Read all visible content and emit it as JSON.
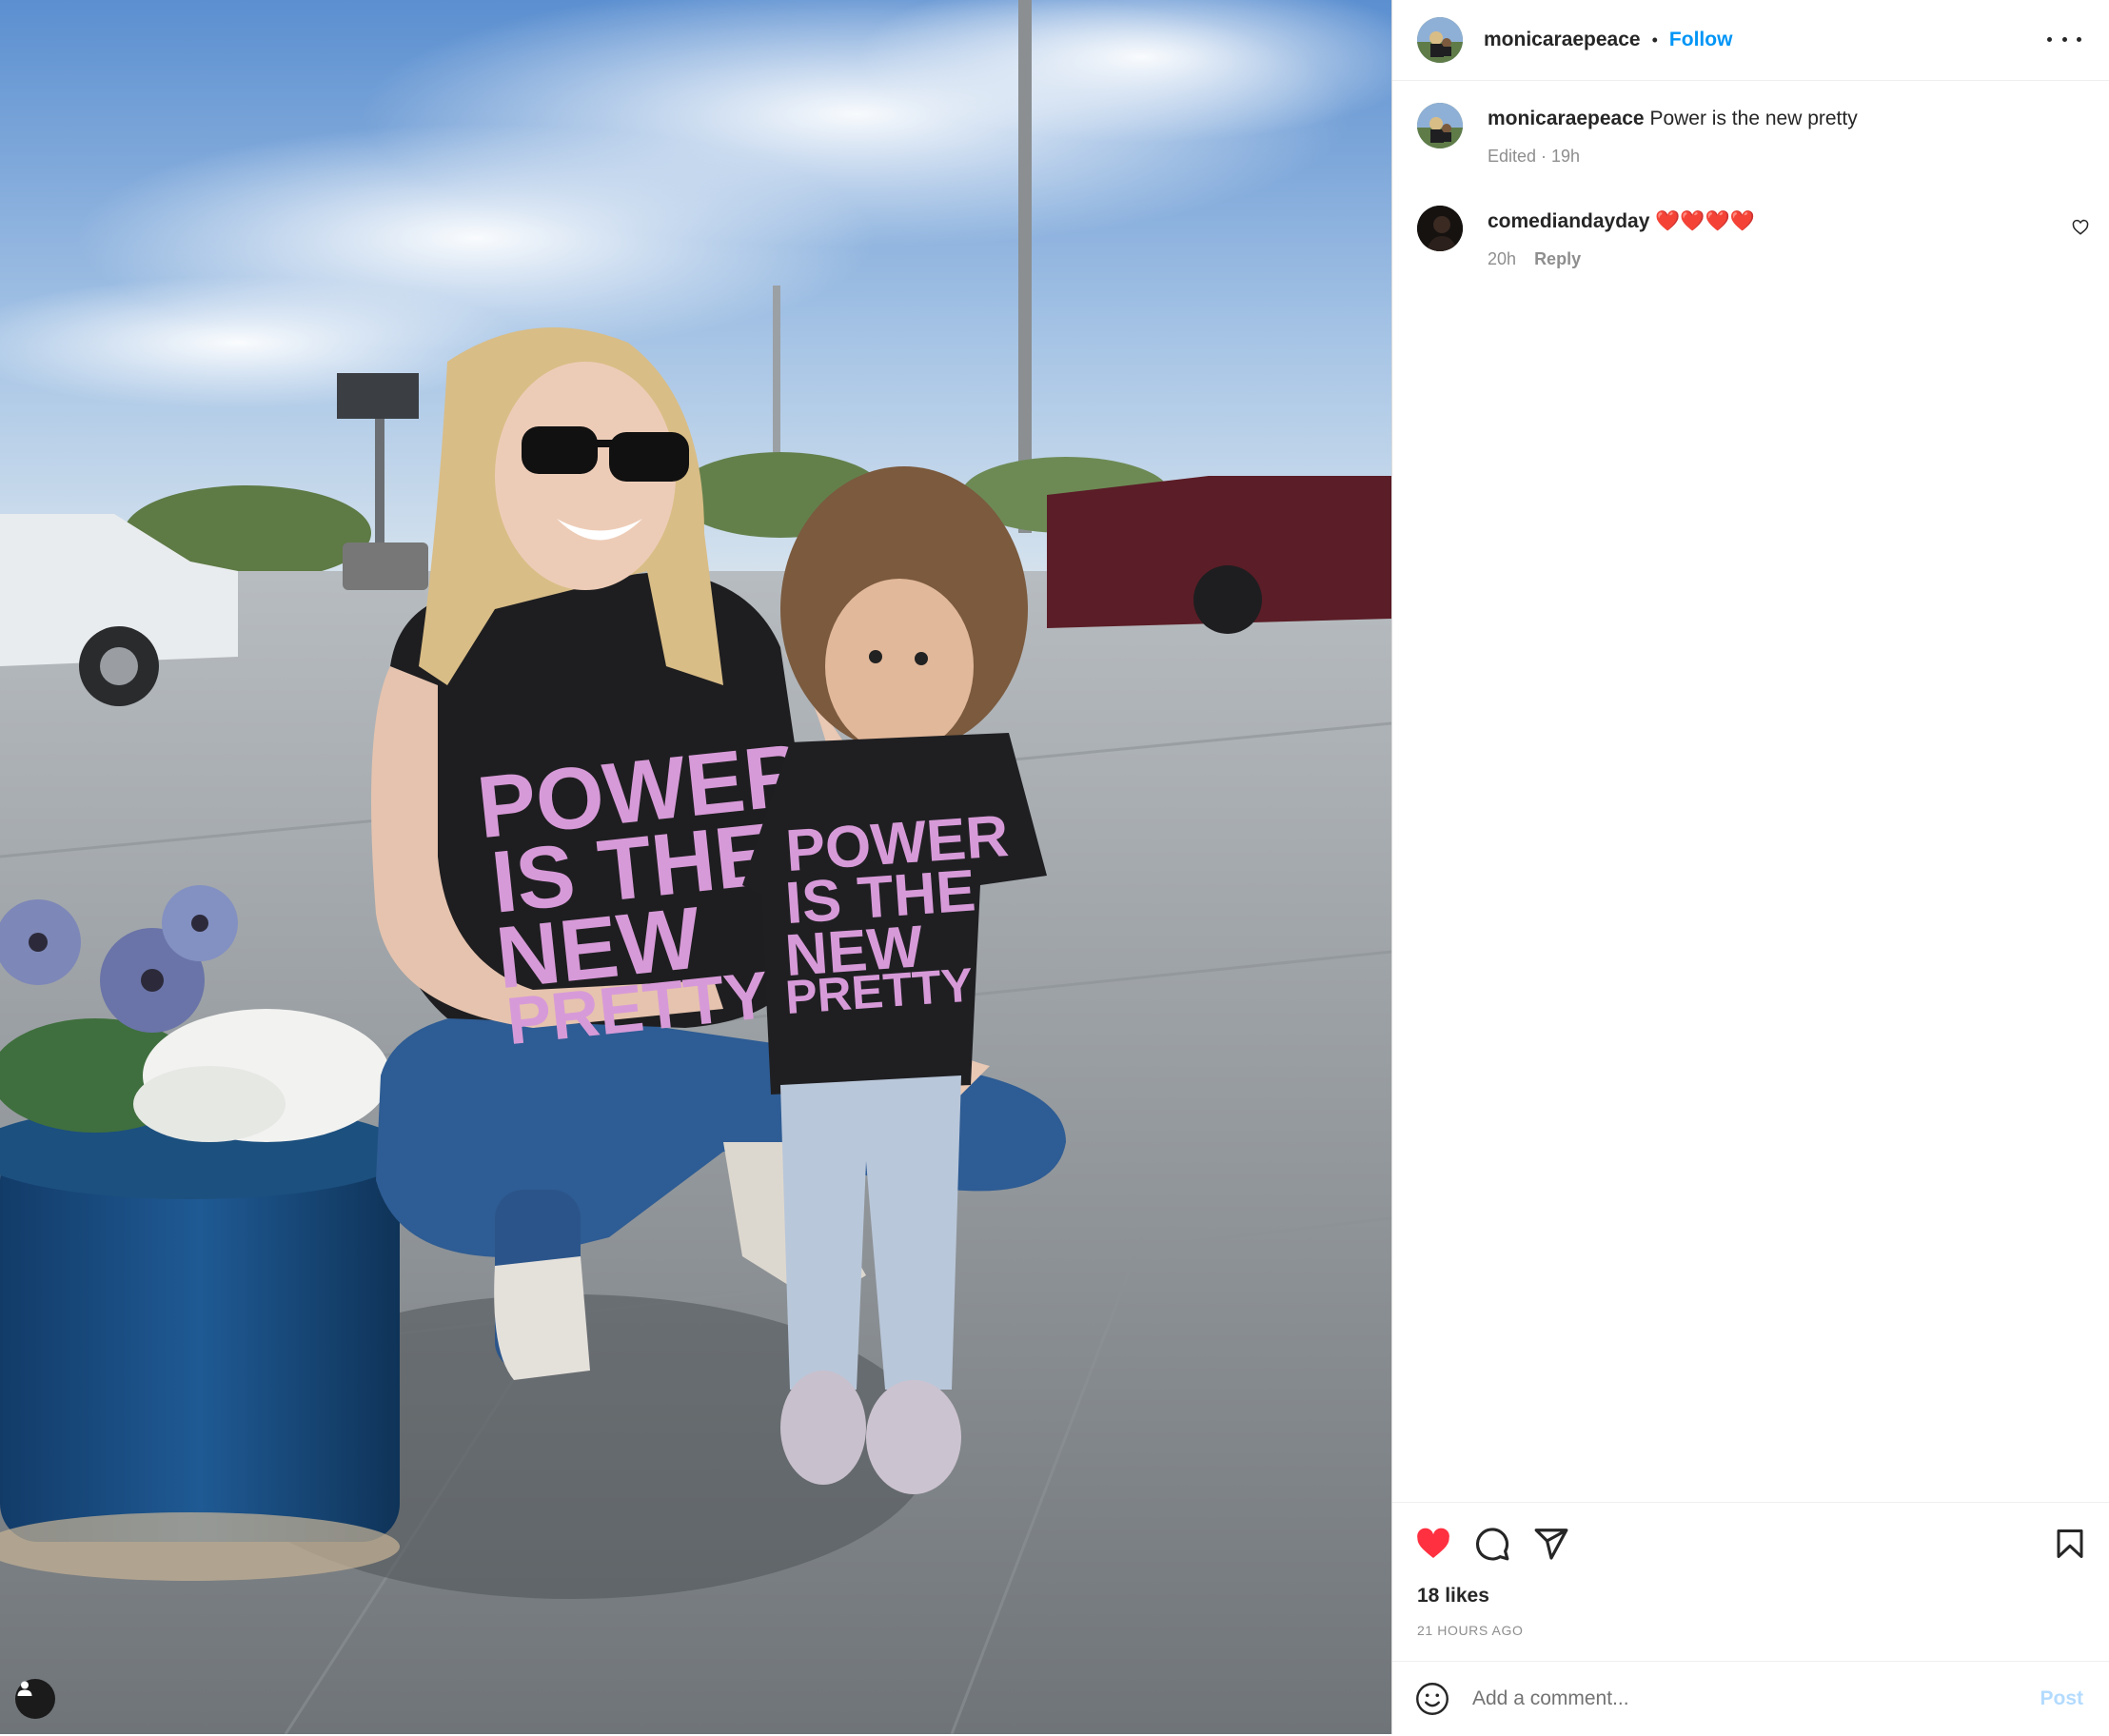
{
  "post": {
    "username": "monicaraepeace",
    "follow_label": "Follow",
    "separator": "•"
  },
  "caption": {
    "username": "monicaraepeace",
    "text": "Power is the new pretty",
    "meta": "Edited · 19h"
  },
  "comments": [
    {
      "username": "comediandayday",
      "text": "❤️❤️❤️❤️",
      "time": "20h",
      "reply_label": "Reply"
    }
  ],
  "photo": {
    "shirt_text": [
      "POWER",
      "IS THE",
      "NEW",
      "PRETTY"
    ]
  },
  "actions": {
    "likes": "18 likes",
    "timestamp": "21 HOURS AGO",
    "liked": true
  },
  "comment_box": {
    "placeholder": "Add a comment...",
    "post_label": "Post"
  },
  "colors": {
    "accent": "#0095f6",
    "like": "#ff3040",
    "post_disabled": "#b3dbff"
  }
}
